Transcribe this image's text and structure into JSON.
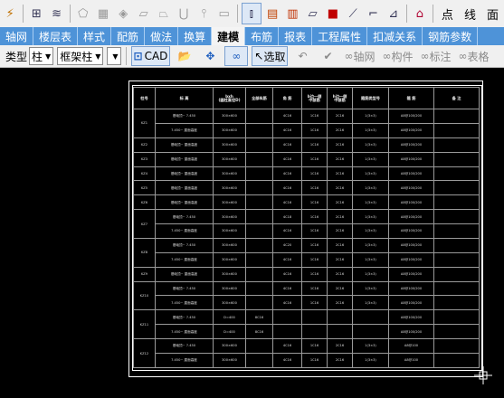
{
  "toolbar1": {
    "text_items": [
      "点",
      "线",
      "面"
    ]
  },
  "menu": {
    "items": [
      "轴网",
      "楼层表",
      "样式",
      "配筋",
      "做法",
      "换算",
      "建模",
      "布筋",
      "报表",
      "工程属性",
      "扣减关系",
      "钢筋参数"
    ],
    "active": "建模"
  },
  "toolbar2": {
    "type_label": "类型",
    "type_value": "柱",
    "subtype_value": "框架柱",
    "cad_label": "CAD",
    "select_label": "选取",
    "axis_label": "轴网",
    "member_label": "构件",
    "annotate_label": "标注",
    "table_label": "表格"
  },
  "table": {
    "headers": [
      "柱号",
      "标 高",
      "bxh\n(圆柱直径D)",
      "全部纵筋",
      "角 筋",
      "b边一侧\n中部筋",
      "h边一侧\n中部筋",
      "箍筋类型号",
      "箍 筋",
      "备 注"
    ],
    "rows": [
      [
        "KZ1",
        "基础顶~ 7.450",
        "300×600",
        "",
        "4C16",
        "1C16",
        "2C16",
        "1(3×3)",
        "A8@100/200",
        ""
      ],
      [
        "",
        "7.450~ 屋面高度",
        "300×600",
        "",
        "4C16",
        "1C16",
        "2C16",
        "1(3×3)",
        "A8@100/200",
        ""
      ],
      [
        "KZ2",
        "基础顶~ 屋面高度",
        "300×600",
        "",
        "4C16",
        "1C16",
        "2C16",
        "1(3×3)",
        "A8@100/200",
        ""
      ],
      [
        "KZ3",
        "基础顶~ 屋面高度",
        "300×600",
        "",
        "4C16",
        "1C16",
        "2C16",
        "1(3×3)",
        "A8@100/200",
        ""
      ],
      [
        "KZ4",
        "基础顶~ 屋面高度",
        "300×600",
        "",
        "4C16",
        "1C16",
        "2C16",
        "1(3×3)",
        "A8@100/200",
        ""
      ],
      [
        "KZ5",
        "基础顶~ 屋面高度",
        "300×600",
        "",
        "4C16",
        "1C16",
        "2C16",
        "1(3×3)",
        "A8@100/200",
        ""
      ],
      [
        "KZ6",
        "基础顶~ 屋面高度",
        "300×600",
        "",
        "4C16",
        "1C16",
        "2C16",
        "1(3×3)",
        "A8@100/200",
        ""
      ],
      [
        "KZ7",
        "基础顶~ 7.450",
        "300×600",
        "",
        "4C18",
        "1C16",
        "2C16",
        "1(3×3)",
        "A8@100/200",
        ""
      ],
      [
        "",
        "7.450~ 屋面高度",
        "300×600",
        "",
        "4C16",
        "1C16",
        "2C16",
        "1(3×3)",
        "A8@100/200",
        ""
      ],
      [
        "KZ8",
        "基础顶~ 7.450",
        "300×600",
        "",
        "4C20",
        "1C16",
        "2C16",
        "1(3×3)",
        "A8@100/200",
        ""
      ],
      [
        "",
        "7.450~ 屋面高度",
        "300×600",
        "",
        "4C16",
        "1C16",
        "2C16",
        "1(3×3)",
        "A8@100/200",
        ""
      ],
      [
        "KZ9",
        "基础顶~ 屋面高度",
        "300×600",
        "",
        "4C16",
        "1C16",
        "2C16",
        "1(3×3)",
        "A8@100/200",
        ""
      ],
      [
        "KZ10",
        "基础顶~ 7.450",
        "300×600",
        "",
        "4C16",
        "1C16",
        "2C16",
        "1(3×3)",
        "A8@100/200",
        ""
      ],
      [
        "",
        "7.450~ 屋面高度",
        "300×600",
        "",
        "4C16",
        "1C16",
        "2C16",
        "1(3×3)",
        "A8@100/200",
        ""
      ],
      [
        "KZ11",
        "基础顶~ 7.450",
        "D=400",
        "8C16",
        "",
        "",
        "",
        "",
        "A8@100/200",
        ""
      ],
      [
        "",
        "7.450~ 屋面高度",
        "D=400",
        "8C16",
        "",
        "",
        "",
        "",
        "A8@100/200",
        ""
      ],
      [
        "KZ12",
        "基础顶~ 7.450",
        "300×600",
        "",
        "4C16",
        "1C16",
        "2C16",
        "1(3×3)",
        "A8@100",
        ""
      ],
      [
        "",
        "7.450~ 屋面高度",
        "300×600",
        "",
        "4C16",
        "1C16",
        "2C16",
        "1(3×3)",
        "A8@100",
        ""
      ]
    ]
  },
  "colors": {
    "menu_bg": "#4e93d8",
    "canvas_bg": "#000000",
    "toolbar_bg": "#f0f0f0"
  }
}
